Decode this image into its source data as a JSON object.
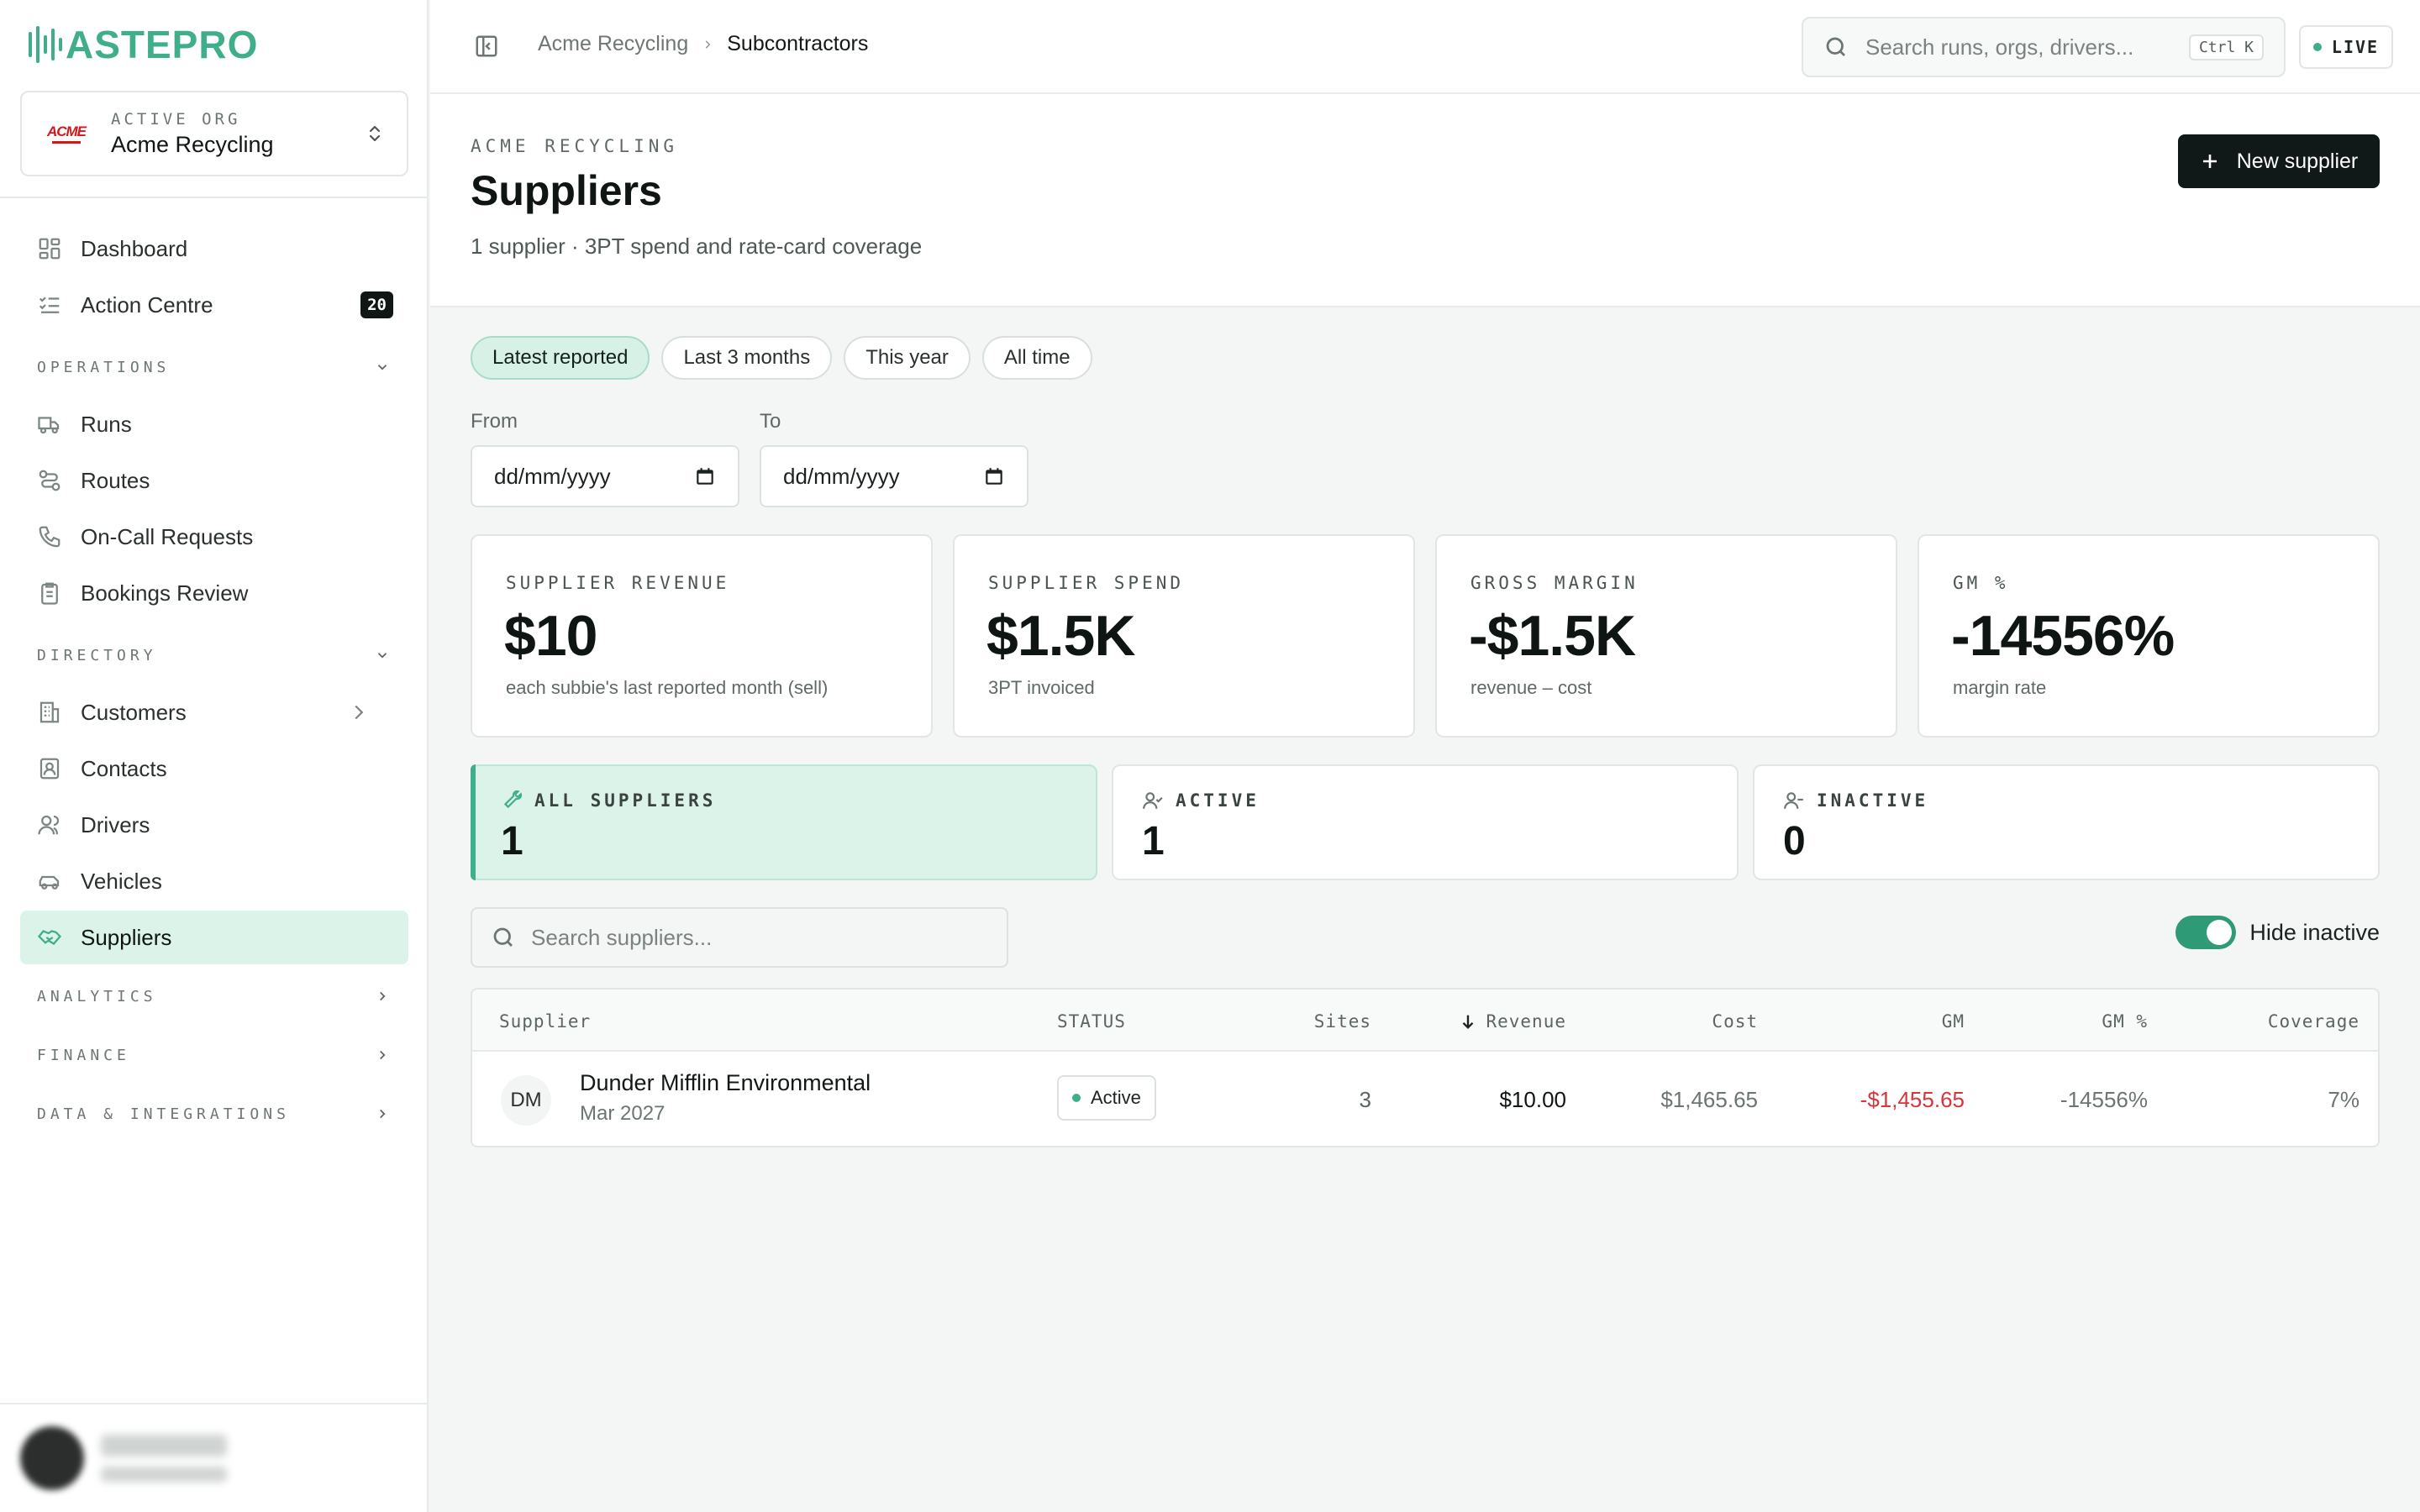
{
  "brand": {
    "name": "ASTEPRO",
    "color": "#3fae8a"
  },
  "org": {
    "label": "ACTIVE ORG",
    "name": "Acme Recycling",
    "logo_text": "ACME"
  },
  "nav": {
    "dashboard": "Dashboard",
    "action_centre": "Action Centre",
    "action_centre_count": "20",
    "sections": {
      "operations": "OPERATIONS",
      "directory": "DIRECTORY",
      "analytics": "ANALYTICS",
      "finance": "FINANCE",
      "data_integrations": "DATA & INTEGRATIONS"
    },
    "operations": [
      "Runs",
      "Routes",
      "On-Call Requests",
      "Bookings Review"
    ],
    "directory": [
      "Customers",
      "Contacts",
      "Drivers",
      "Vehicles",
      "Suppliers"
    ]
  },
  "topbar": {
    "breadcrumb": [
      "Acme Recycling",
      "Subcontractors"
    ],
    "search_placeholder": "Search runs, orgs, drivers...",
    "shortcut": "Ctrl K",
    "live": "LIVE"
  },
  "header": {
    "eyebrow": "ACME RECYCLING",
    "title": "Suppliers",
    "subtitle": "1 supplier · 3PT spend and rate-card coverage",
    "new_button": "New supplier"
  },
  "filters": {
    "ranges": [
      "Latest reported",
      "Last 3 months",
      "This year",
      "All time"
    ],
    "active_range": "Latest reported",
    "from_label": "From",
    "to_label": "To",
    "from_value": "dd/mm/yyyy",
    "to_value": "dd/mm/yyyy"
  },
  "kpis": [
    {
      "label": "SUPPLIER REVENUE",
      "value": "$10",
      "note": "each subbie's last reported month (sell)"
    },
    {
      "label": "SUPPLIER SPEND",
      "value": "$1.5K",
      "note": "3PT invoiced"
    },
    {
      "label": "GROSS MARGIN",
      "value": "-$1.5K",
      "note": "revenue – cost"
    },
    {
      "label": "GM %",
      "value": "-14556%",
      "note": "margin rate"
    }
  ],
  "status_cards": [
    {
      "label": "ALL SUPPLIERS",
      "value": "1"
    },
    {
      "label": "ACTIVE",
      "value": "1"
    },
    {
      "label": "INACTIVE",
      "value": "0"
    }
  ],
  "table_controls": {
    "search_placeholder": "Search suppliers...",
    "hide_inactive_label": "Hide inactive",
    "hide_inactive": true
  },
  "table": {
    "columns": [
      "Supplier",
      "STATUS",
      "Sites",
      "Revenue",
      "Cost",
      "GM",
      "GM %",
      "Coverage"
    ],
    "rows": [
      {
        "initials": "DM",
        "name": "Dunder Mifflin Environmental",
        "date": "Mar 2027",
        "status": "Active",
        "sites": "3",
        "revenue": "$10.00",
        "cost": "$1,465.65",
        "gm": "-$1,455.65",
        "gm_pct": "-14556%",
        "coverage": "7%"
      }
    ]
  },
  "colors": {
    "accent": "#3fae8a",
    "negative": "#d9343a",
    "dark_button": "#111918"
  }
}
